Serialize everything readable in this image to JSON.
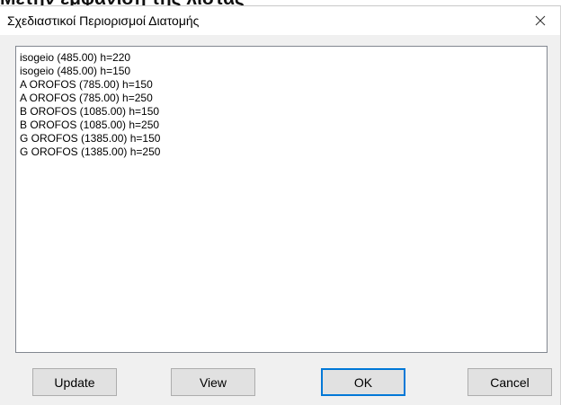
{
  "background_caption": "Μετην εμφάνιση της λίστας",
  "dialog": {
    "title": "Σχεδιαστικοί Περιορισμοί Διατομής",
    "close_glyph": "✕"
  },
  "list": {
    "items": [
      "isogeio (485.00) h=220",
      "isogeio (485.00) h=150",
      "A OROFOS (785.00) h=150",
      "A OROFOS (785.00) h=250",
      "B OROFOS (1085.00) h=150",
      "B OROFOS (1085.00) h=250",
      "G OROFOS (1385.00) h=150",
      "G OROFOS (1385.00) h=250"
    ]
  },
  "buttons": {
    "update_label": "Update",
    "view_label": "View",
    "ok_label": "OK",
    "cancel_label": "Cancel"
  },
  "colors": {
    "focus_border": "#0078d7",
    "dialog_background": "#f0f0f0"
  }
}
